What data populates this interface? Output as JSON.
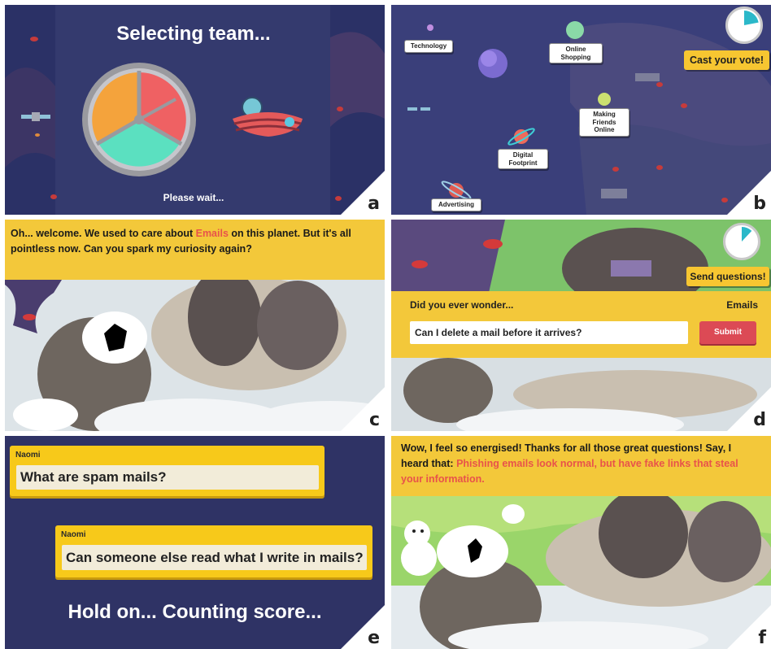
{
  "panels": {
    "a": {
      "corner_label": "a",
      "title": "Selecting team...",
      "footer": "Please wait...",
      "spinner_colors": [
        "#f4a33c",
        "#ef6163",
        "#5be0c0"
      ]
    },
    "b": {
      "corner_label": "b",
      "cast_vote": "Cast your vote!",
      "topics": [
        "Technology",
        "Online Shopping",
        "Making Friends Online",
        "Digital Footprint",
        "Advertising"
      ],
      "timer_fill_fraction": 0.22
    },
    "c": {
      "corner_label": "c",
      "dialog_part1": "Oh... welcome. We used to care about ",
      "dialog_highlight": "Emails",
      "dialog_part2": " on this planet. But it's all pointless now. Can you spark my curiosity again?"
    },
    "d": {
      "corner_label": "d",
      "send_questions": "Send questions!",
      "prompt_label": "Did you ever wonder...",
      "topic_label": "Emails",
      "input_value": "Can I delete a mail before it arrives?",
      "submit_label": "Submit",
      "timer_fill_fraction": 0.12
    },
    "e": {
      "corner_label": "e",
      "questions": [
        {
          "author": "Naomi",
          "text": "What are spam mails?"
        },
        {
          "author": "Naomi",
          "text": "Can someone else read what I write in mails?"
        }
      ],
      "status": "Hold on... Counting score..."
    },
    "f": {
      "corner_label": "f",
      "dialog_part1": "Wow, I feel so energised! Thanks for all those great questions! Say, I heard that: ",
      "dialog_highlight": "Phishing emails look normal, but have fake links that steal your information."
    }
  },
  "colors": {
    "space_bg": "#343a6e",
    "accent_yellow": "#f3c83a",
    "highlight_red": "#e8534a",
    "submit_red": "#dc4a55",
    "timer_cyan": "#2bb8c9"
  }
}
